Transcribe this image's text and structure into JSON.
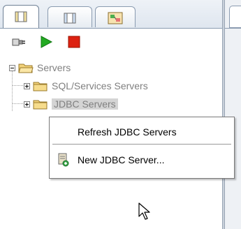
{
  "tabs": [
    {
      "name": "servers-tab",
      "icon": "cylinder-icon",
      "active": true
    },
    {
      "name": "databases-tab",
      "icon": "cylinder-icon",
      "active": false
    },
    {
      "name": "diagram-tab",
      "icon": "diagram-icon",
      "active": false
    }
  ],
  "toolbar": {
    "buttons": [
      {
        "name": "connect-button",
        "icon": "plug-icon"
      },
      {
        "name": "start-button",
        "icon": "play-icon"
      },
      {
        "name": "stop-button",
        "icon": "stop-icon"
      }
    ]
  },
  "tree": {
    "root": {
      "label": "Servers",
      "expanded": true
    },
    "children": [
      {
        "label": "SQL/Services Servers",
        "expanded": false
      },
      {
        "label": "JDBC Servers",
        "expanded": false,
        "selected": true
      }
    ]
  },
  "context_menu": {
    "items": [
      {
        "label": "Refresh JDBC Servers"
      },
      {
        "label": "New JDBC Server...",
        "icon": "new-server-icon"
      }
    ]
  },
  "colors": {
    "play": "#22aa22",
    "stop": "#dd2211",
    "folder": "#f2d27a",
    "selection": "#d4d4d4"
  }
}
